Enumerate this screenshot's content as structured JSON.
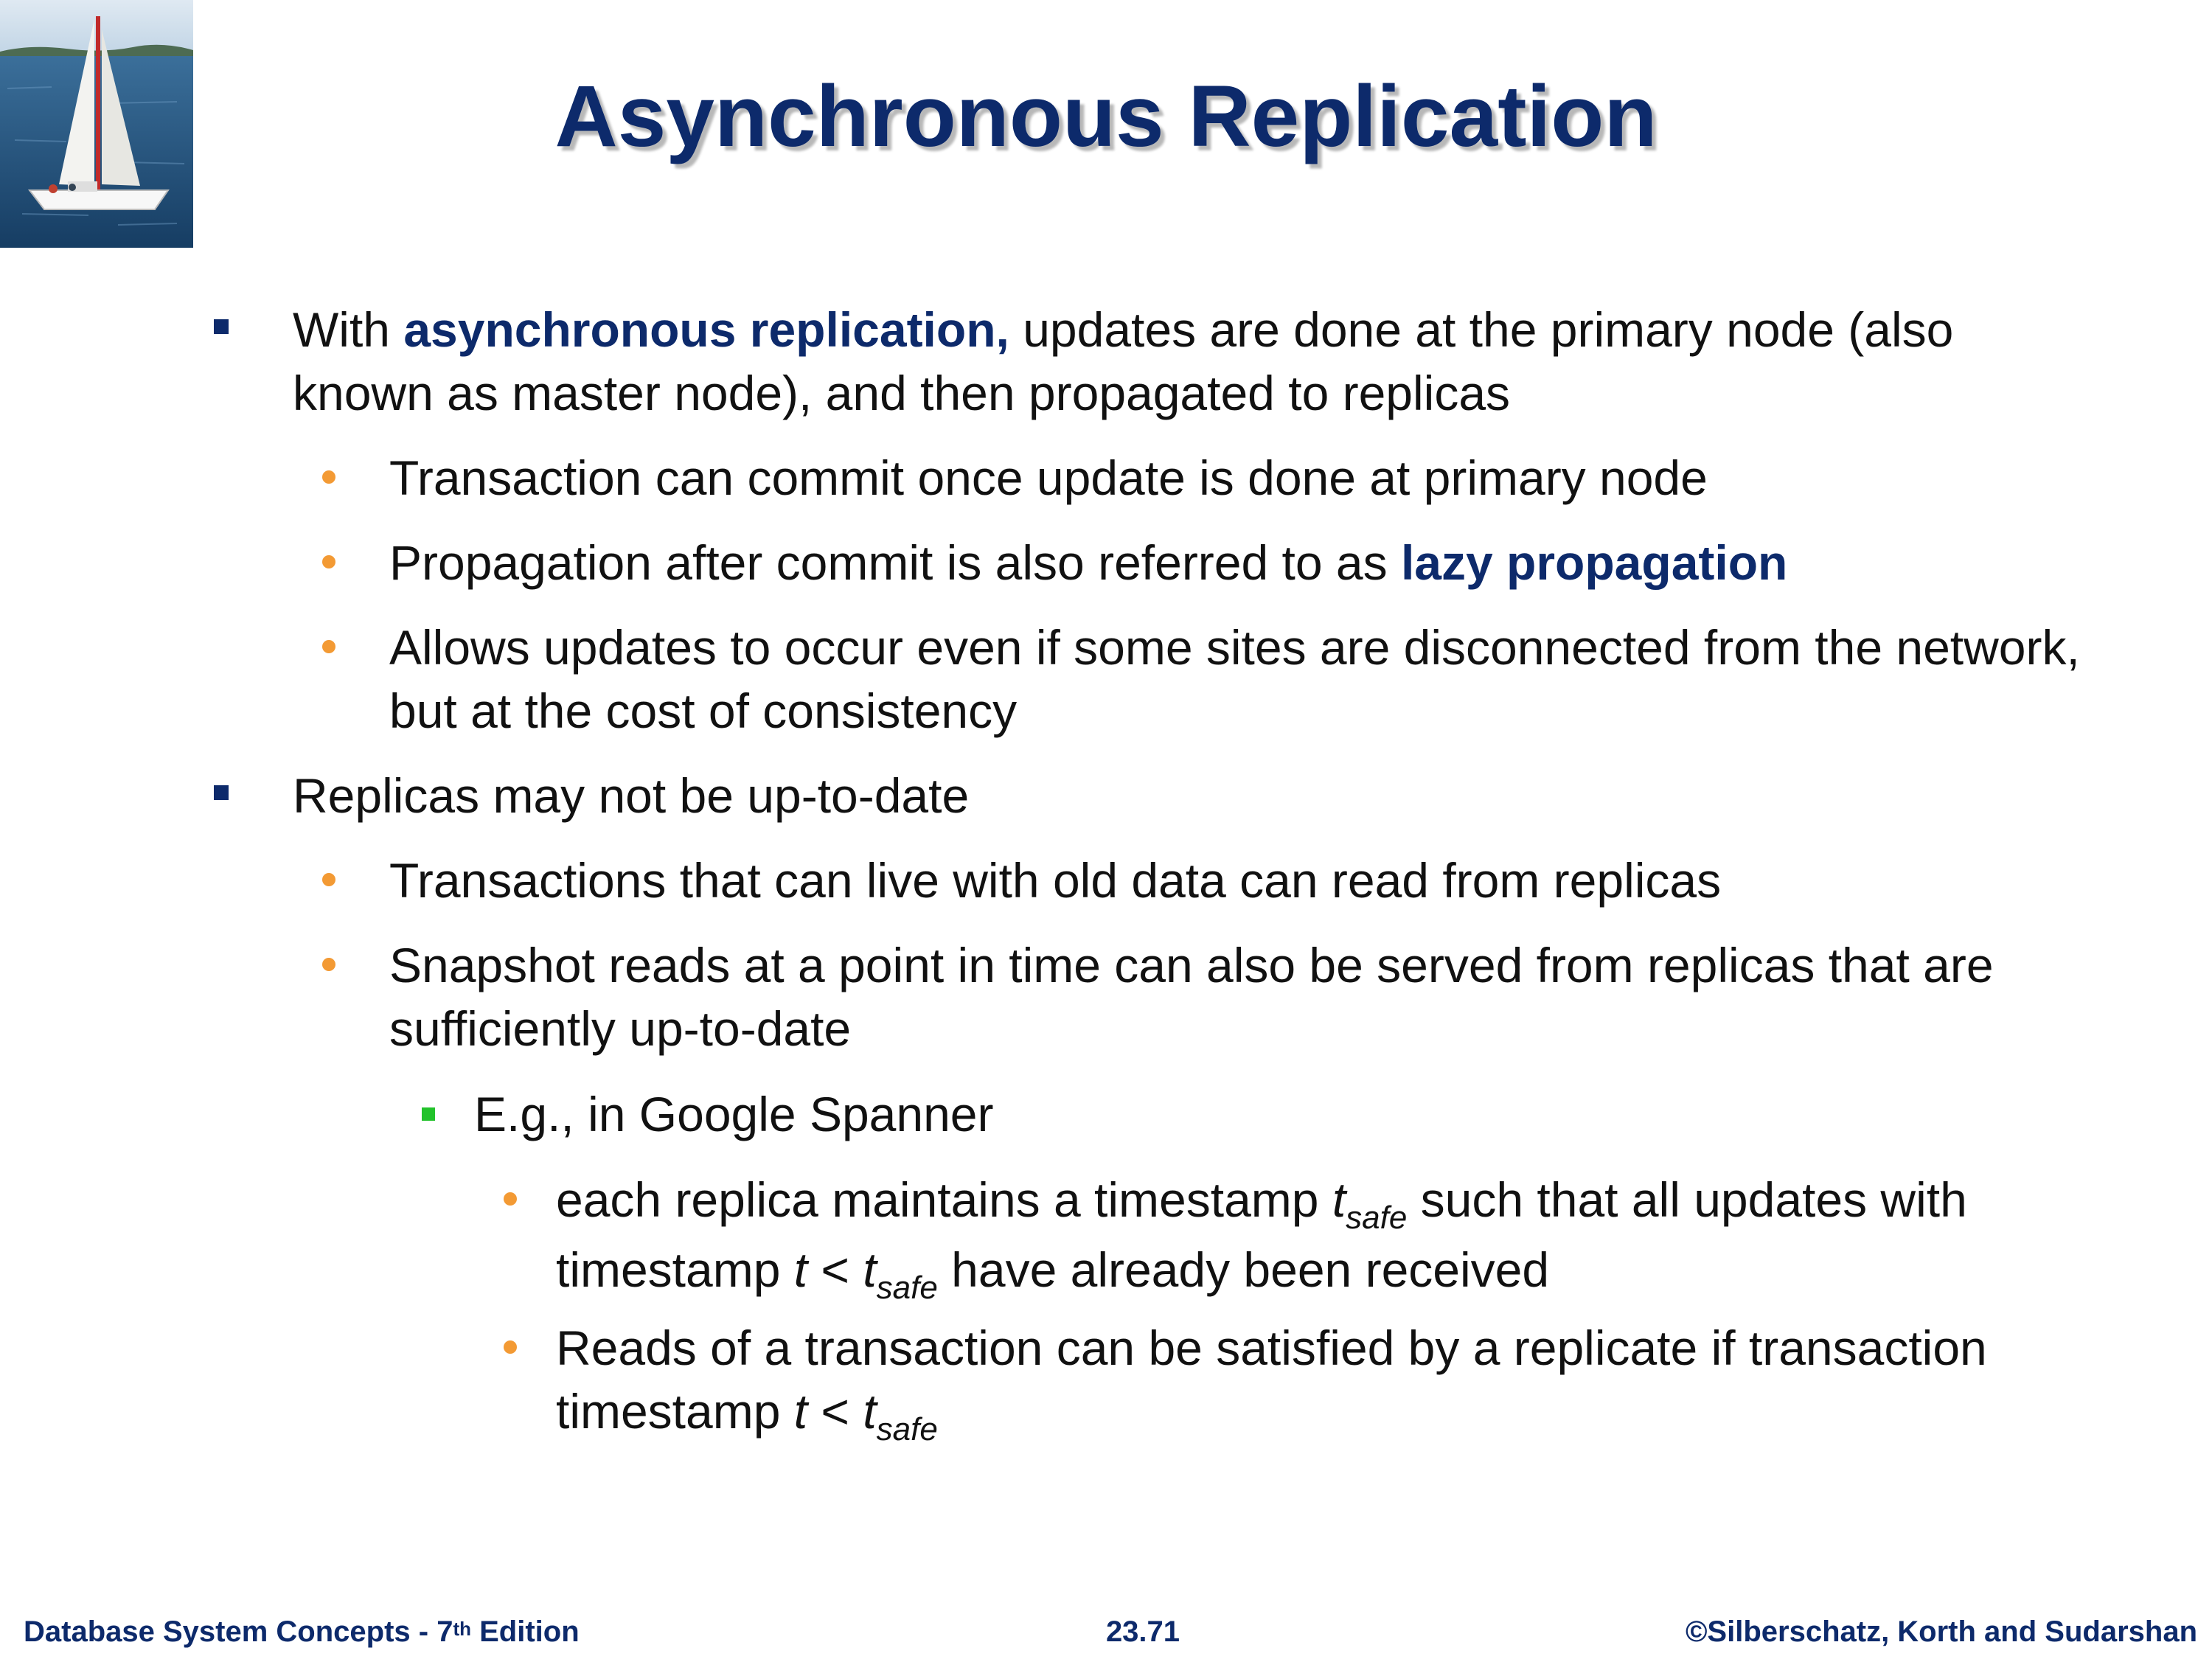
{
  "slide": {
    "title": "Asynchronous Replication",
    "bullets": [
      {
        "pre": "With ",
        "highlight": "asynchronous replication,",
        "post": " updates are done at the primary node (also known as master node), and then propagated to replicas"
      },
      {
        "text": "Transaction can commit once update is done at primary node"
      },
      {
        "pre": "Propagation after commit is also referred to as ",
        "highlight": "lazy propagation"
      },
      {
        "text": "Allows updates to occur even if some sites are disconnected from the network, but at the cost of consistency"
      },
      {
        "text": "Replicas may not be up-to-date"
      },
      {
        "text": "Transactions that can live with old data can read from replicas"
      },
      {
        "text": "Snapshot reads at a point in time can also be served from replicas that are sufficiently up-to-date"
      },
      {
        "text": "E.g., in Google Spanner"
      },
      {
        "pre": "each replica maintains a timestamp ",
        "t_var": "t",
        "sub": "safe",
        "mid": " such that all updates with timestamp ",
        "t_var2": "t",
        "lt": " < ",
        "t_var3": "t",
        "sub2": "safe",
        "post": " have already been received"
      },
      {
        "pre": "Reads of a transaction can be satisfied by a replicate if transaction timestamp ",
        "t_var": "t",
        "lt": " < ",
        "t_var2": "t",
        "sub": "safe"
      }
    ]
  },
  "footer": {
    "left": "Database System Concepts - 7",
    "left_sup": "th",
    "left_post": " Edition",
    "center": "23.71",
    "right": "©Silberschatz, Korth and Sudarshan"
  },
  "colors": {
    "title": "#0d2a6b",
    "highlight": "#0d2a6b",
    "level1_marker": "#0d2a6b",
    "level2_marker": "#f39a34",
    "level3_marker": "#22c22b"
  },
  "icons": {
    "logo": "sailboat-image"
  }
}
